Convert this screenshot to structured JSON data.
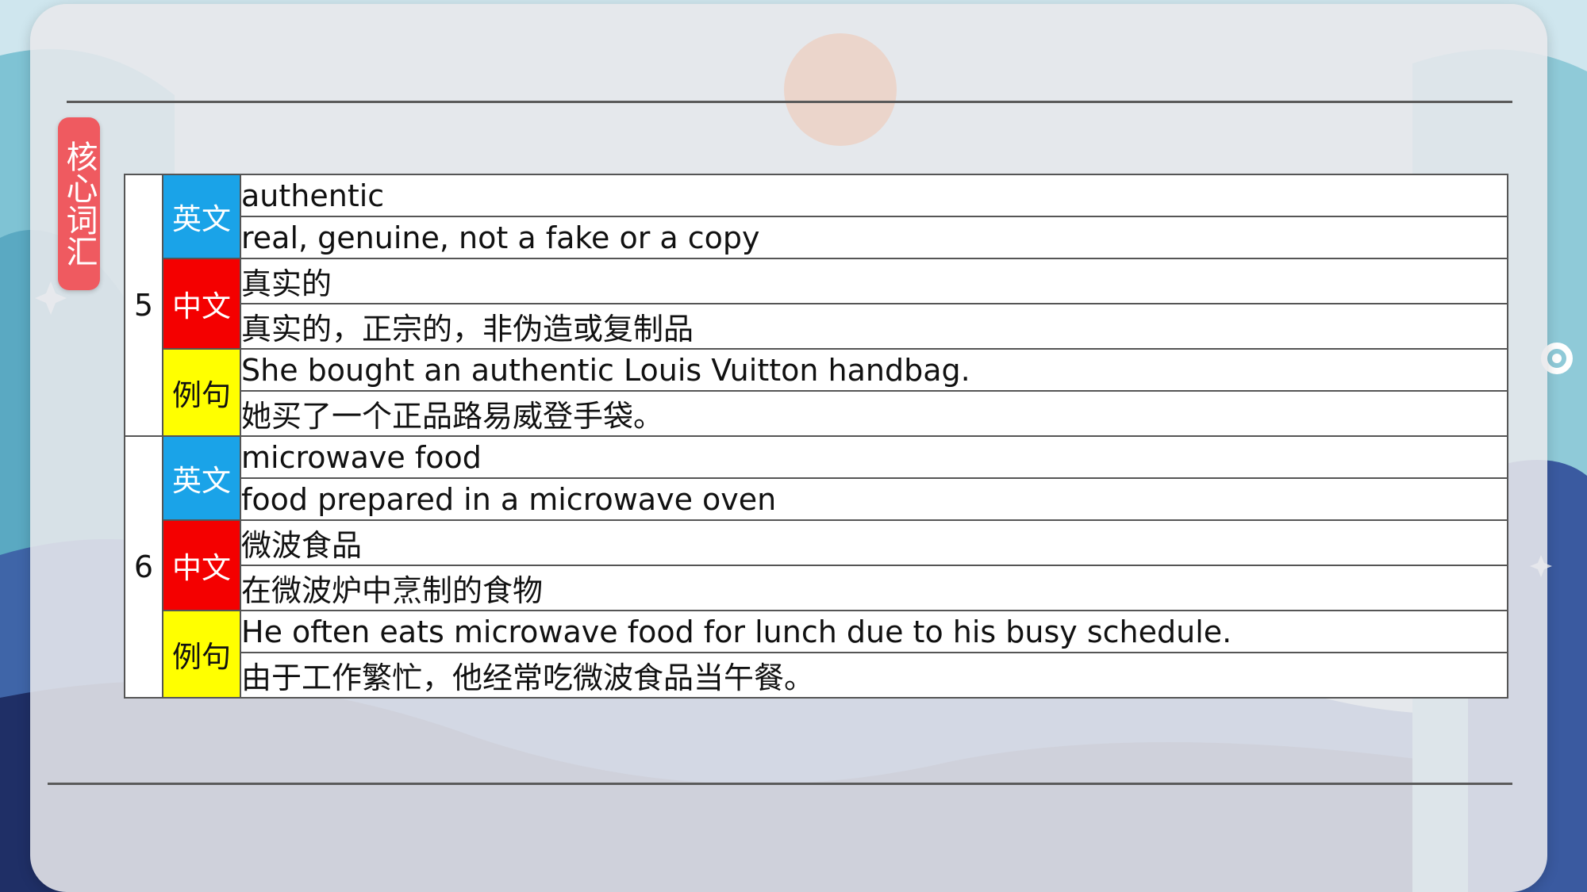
{
  "side_tag": "核心词汇",
  "entries": [
    {
      "number": "5",
      "english_label": "英文",
      "word": "authentic",
      "definition": "real, genuine, not a fake or a copy",
      "chinese_label": "中文",
      "translation": "真实的",
      "translation_detail": "真实的，正宗的，非伪造或复制品",
      "example_label": "例句",
      "example": "She bought an authentic Louis Vuitton handbag.",
      "example_translation": "她买了一个正品路易威登手袋。"
    },
    {
      "number": "6",
      "english_label": "英文",
      "word": "microwave food",
      "definition": "food prepared in a microwave oven",
      "chinese_label": "中文",
      "translation": "微波食品",
      "translation_detail": "在微波炉中烹制的食物",
      "example_label": "例句",
      "example": "He often eats microwave food for lunch due to his busy schedule.",
      "example_translation": "由于工作繁忙，他经常吃微波食品当午餐。"
    }
  ],
  "colors": {
    "english_tag": "#1aa3e8",
    "chinese_tag": "#f40000",
    "example_tag": "#ffff00",
    "side_tag": "#ef5a60"
  },
  "icons": [
    "gear-icon",
    "sparkle-icon"
  ]
}
